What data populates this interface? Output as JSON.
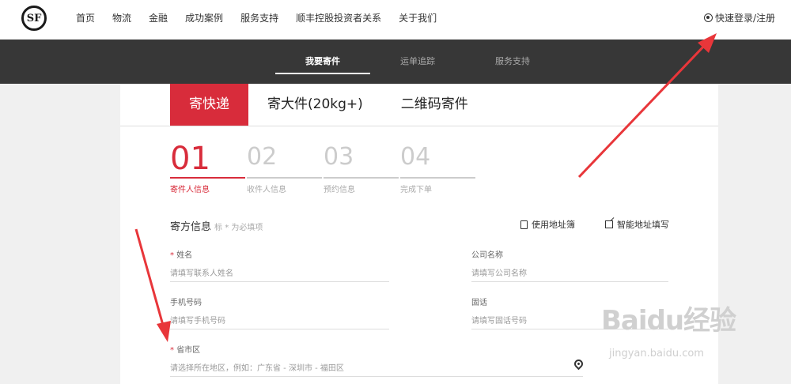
{
  "header": {
    "logo_text": "SF",
    "nav": [
      "首页",
      "物流",
      "金融",
      "成功案例",
      "服务支持",
      "顺丰控股投资者关系",
      "关于我们"
    ],
    "login": "快速登录/注册"
  },
  "subnav": {
    "tabs": [
      "我要寄件",
      "运单追踪",
      "服务支持"
    ]
  },
  "main_tabs": [
    "寄快递",
    "寄大件(20kg+)",
    "二维码寄件"
  ],
  "steps": [
    {
      "num": "01",
      "label": "寄件人信息"
    },
    {
      "num": "02",
      "label": "收件人信息"
    },
    {
      "num": "03",
      "label": "预约信息"
    },
    {
      "num": "04",
      "label": "完成下单"
    }
  ],
  "section": {
    "title": "寄方信息",
    "hint": "标 * 为必填项",
    "address_book": "使用地址簿",
    "smart_fill": "智能地址填写"
  },
  "fields": {
    "name": {
      "required": "*",
      "label": "姓名",
      "placeholder": "请填写联系人姓名"
    },
    "company": {
      "label": "公司名称",
      "placeholder": "请填写公司名称"
    },
    "mobile": {
      "label": "手机号码",
      "placeholder": "请填写手机号码"
    },
    "phone": {
      "label": "固话",
      "placeholder": "请填写固话号码"
    },
    "region": {
      "required": "*",
      "label": "省市区",
      "placeholder": "请选择所在地区，例如：广东省 - 深圳市 - 福田区"
    }
  },
  "watermark": {
    "brand": "Baidu经验",
    "url": "jingyan.baidu.com"
  },
  "colors": {
    "accent": "#d82c3b",
    "dark_bar": "#373737",
    "annotation_arrow": "#e8363a"
  }
}
